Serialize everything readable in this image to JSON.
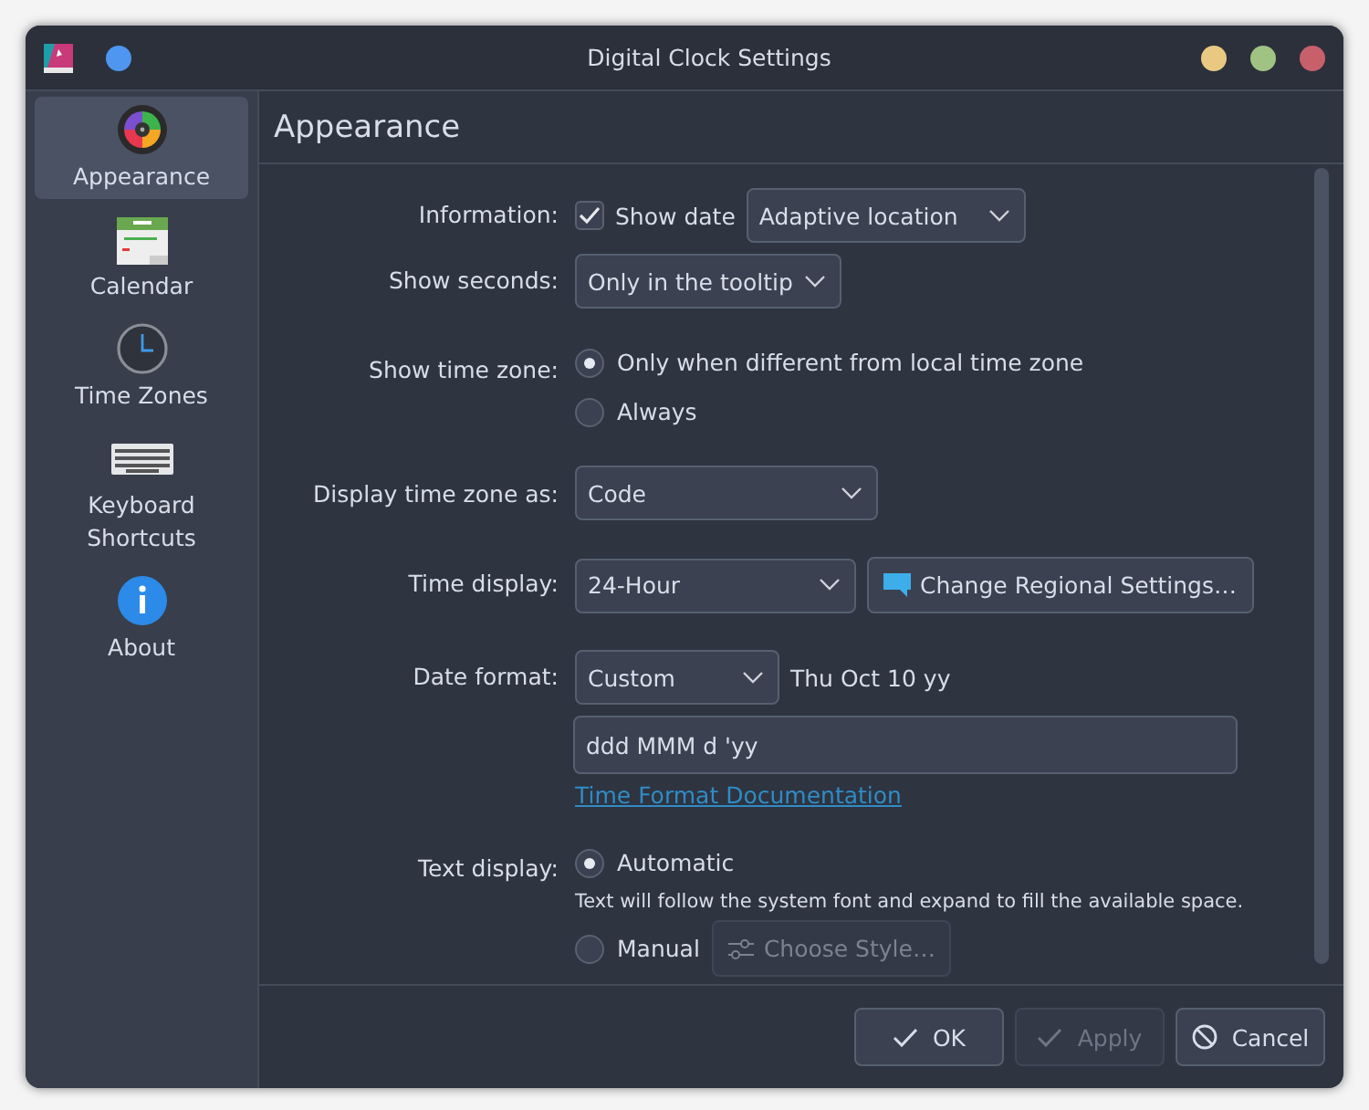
{
  "window": {
    "title": "Digital Clock Settings"
  },
  "sidebar": {
    "items": [
      {
        "label": "Appearance",
        "selected": true
      },
      {
        "label": "Calendar",
        "selected": false
      },
      {
        "label": "Time Zones",
        "selected": false
      },
      {
        "label": "Keyboard Shortcuts",
        "selected": false
      },
      {
        "label": "About",
        "selected": false
      }
    ]
  },
  "page": {
    "title": "Appearance"
  },
  "information": {
    "label": "Information:",
    "checkbox": {
      "label": "Show date",
      "checked": true
    },
    "dropdown": {
      "value": "Adaptive location"
    }
  },
  "show_seconds": {
    "label": "Show seconds:",
    "dropdown": {
      "value": "Only in the tooltip"
    }
  },
  "show_time_zone": {
    "label": "Show time zone:",
    "options": [
      {
        "label": "Only when different from local time zone",
        "selected": true
      },
      {
        "label": "Always",
        "selected": false
      }
    ]
  },
  "display_time_zone_as": {
    "label": "Display time zone as:",
    "dropdown": {
      "value": "Code"
    }
  },
  "time_display": {
    "label": "Time display:",
    "dropdown": {
      "value": "24-Hour"
    },
    "button": {
      "label": "Change Regional Settings…"
    }
  },
  "date_format": {
    "label": "Date format:",
    "dropdown": {
      "value": "Custom"
    },
    "preview": "Thu Oct 10 yy",
    "field": {
      "value": "ddd MMM d 'yy"
    },
    "link": "Time Format Documentation"
  },
  "text_display": {
    "label": "Text display:",
    "options": [
      {
        "label": "Automatic",
        "selected": true
      },
      {
        "label": "Manual",
        "selected": false
      }
    ],
    "note": "Text will follow the system font and expand to fill the available space.",
    "style_button": {
      "label": "Choose Style…",
      "disabled": true
    }
  },
  "buttons": [
    {
      "label": "OK",
      "disabled": false
    },
    {
      "label": "Apply",
      "disabled": true
    },
    {
      "label": "Cancel",
      "disabled": false
    }
  ]
}
